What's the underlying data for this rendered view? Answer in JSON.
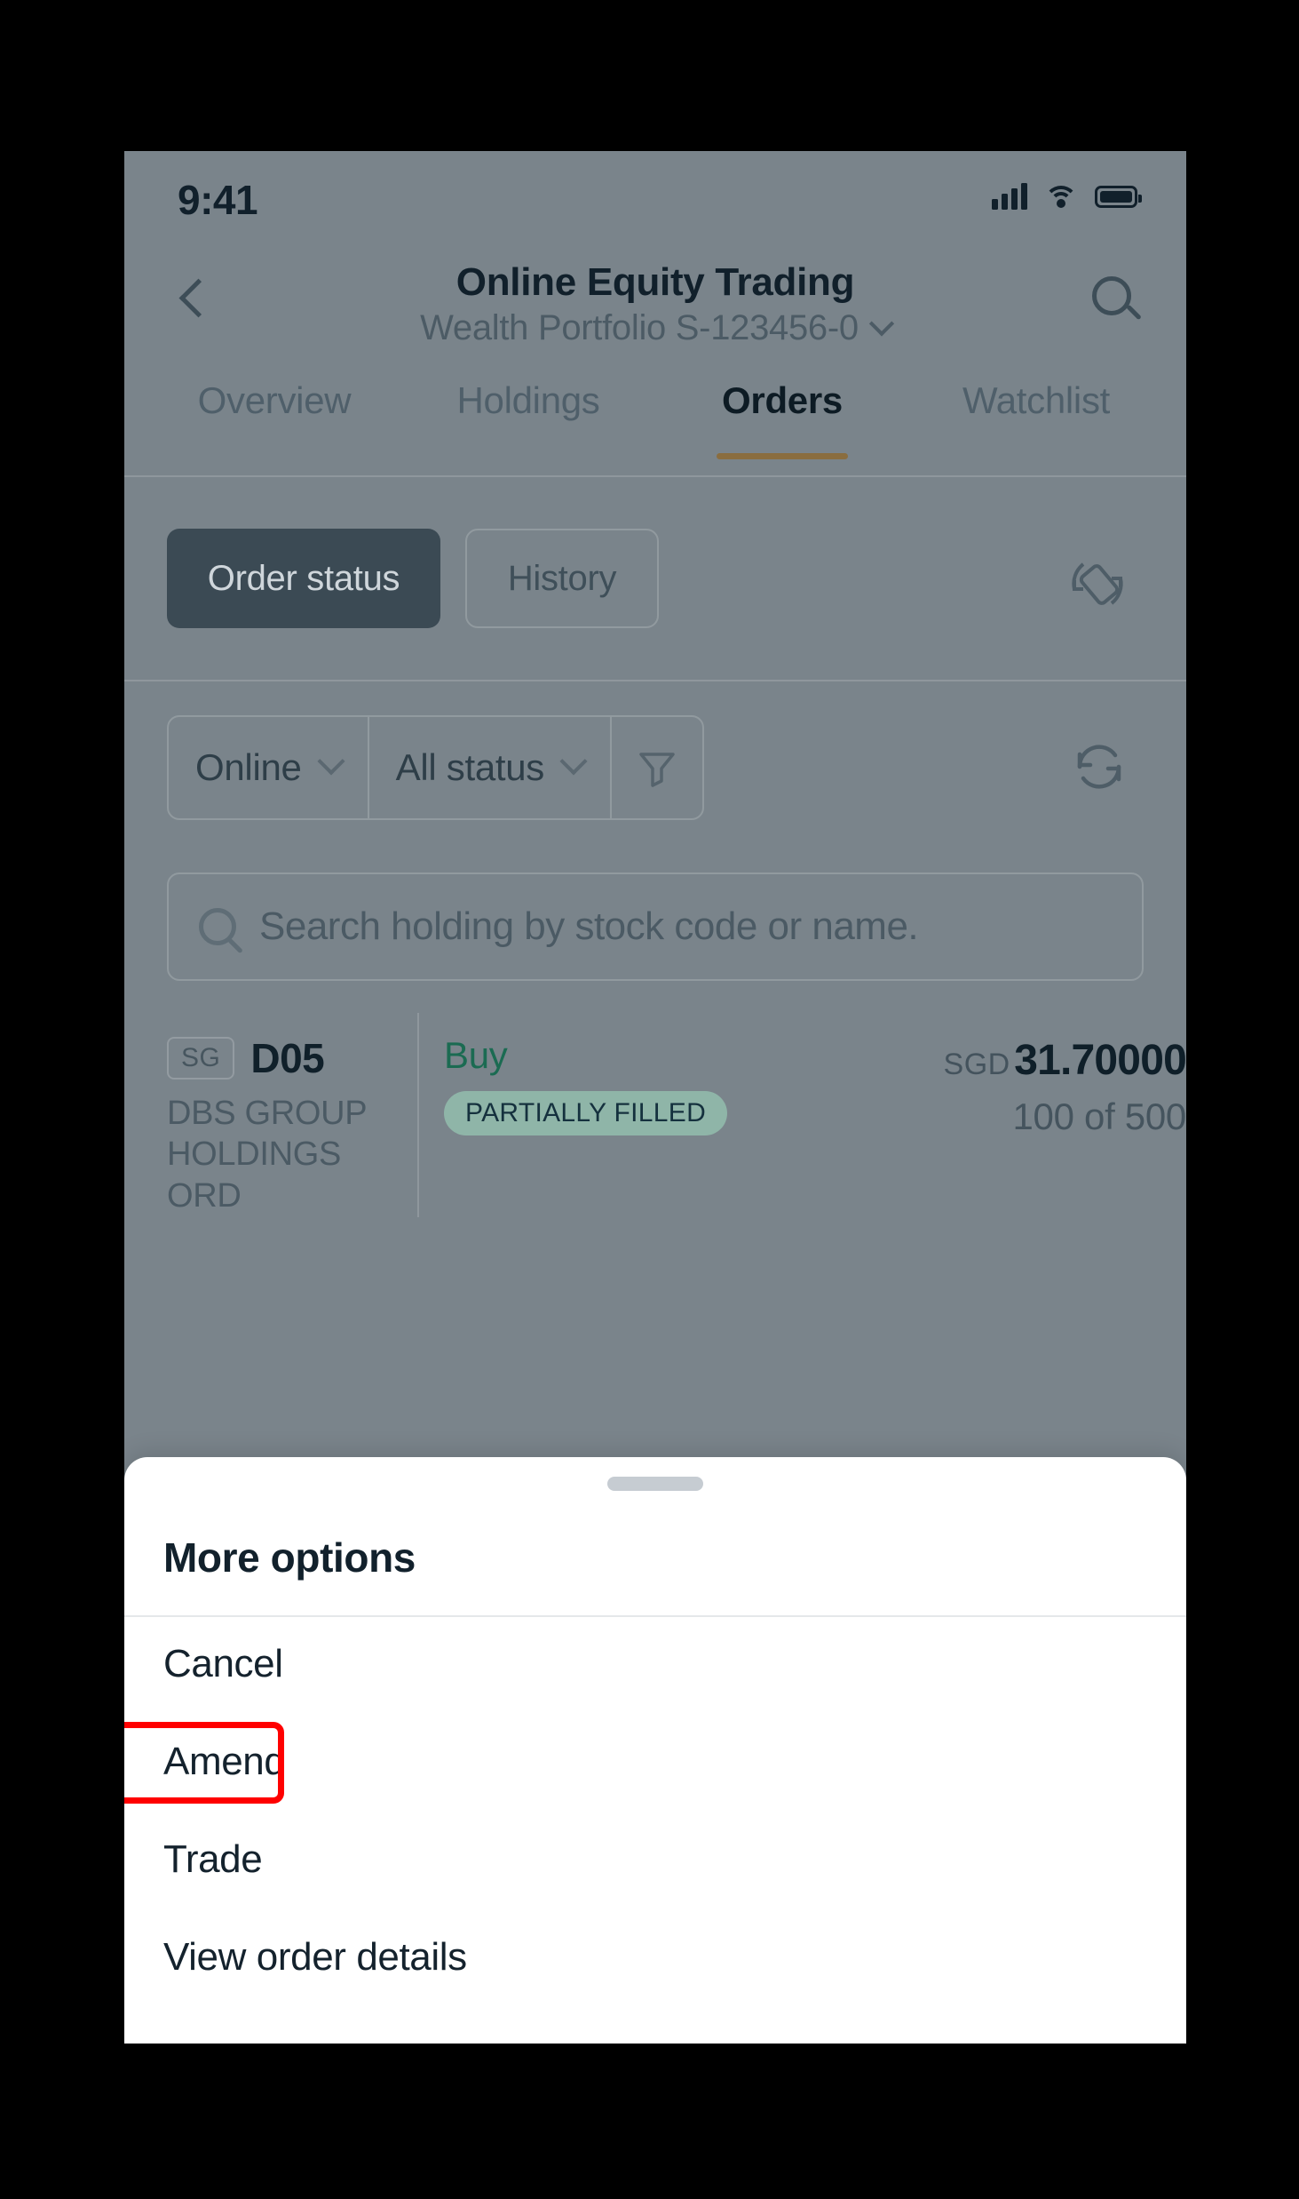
{
  "status_bar": {
    "time": "9:41",
    "cellular_icon": "signal-bars-icon",
    "wifi_icon": "wifi-icon",
    "battery_icon": "battery-icon"
  },
  "header": {
    "back_icon": "chevron-left-icon",
    "title": "Online Equity Trading",
    "subtitle": "Wealth Portfolio S-123456-0",
    "subtitle_chevron_icon": "chevron-down-icon",
    "search_icon": "search-icon"
  },
  "tabs": [
    {
      "label": "Overview",
      "active": false
    },
    {
      "label": "Holdings",
      "active": false
    },
    {
      "label": "Orders",
      "active": true
    },
    {
      "label": "Watchlist",
      "active": false
    }
  ],
  "segments": {
    "order_status_label": "Order status",
    "history_label": "History",
    "rotate_icon": "rotate-device-icon"
  },
  "filters": {
    "channel_value": "Online",
    "channel_chevron_icon": "chevron-down-icon",
    "status_value": "All status",
    "status_chevron_icon": "chevron-down-icon",
    "filter_icon": "funnel-filter-icon",
    "refresh_icon": "refresh-icon"
  },
  "search": {
    "icon": "search-icon",
    "placeholder": "Search holding by stock code or name.",
    "value": ""
  },
  "order": {
    "market_badge": "SG",
    "stock_code": "D05",
    "stock_name": "DBS GROUP HOLDINGS ORD",
    "side": "Buy",
    "status": "PARTIALLY FILLED",
    "currency": "SGD",
    "price": "31.70000",
    "quantity": "100 of 500"
  },
  "sheet": {
    "grabber_icon": "drag-handle-icon",
    "title": "More options",
    "items": [
      {
        "label": "Cancel",
        "highlighted": false
      },
      {
        "label": "Amend",
        "highlighted": true
      },
      {
        "label": "Trade",
        "highlighted": false
      },
      {
        "label": "View order details",
        "highlighted": false
      }
    ]
  },
  "colors": {
    "accent_underline": "#8a6d3f",
    "segment_active_bg": "#3b4a54",
    "buy_green": "#1b6b52",
    "status_pill_bg": "#8fb5a8",
    "highlight_red": "#ff0000",
    "sheet_bg": "#ffffff",
    "dim_overlay": "#7a848b"
  }
}
